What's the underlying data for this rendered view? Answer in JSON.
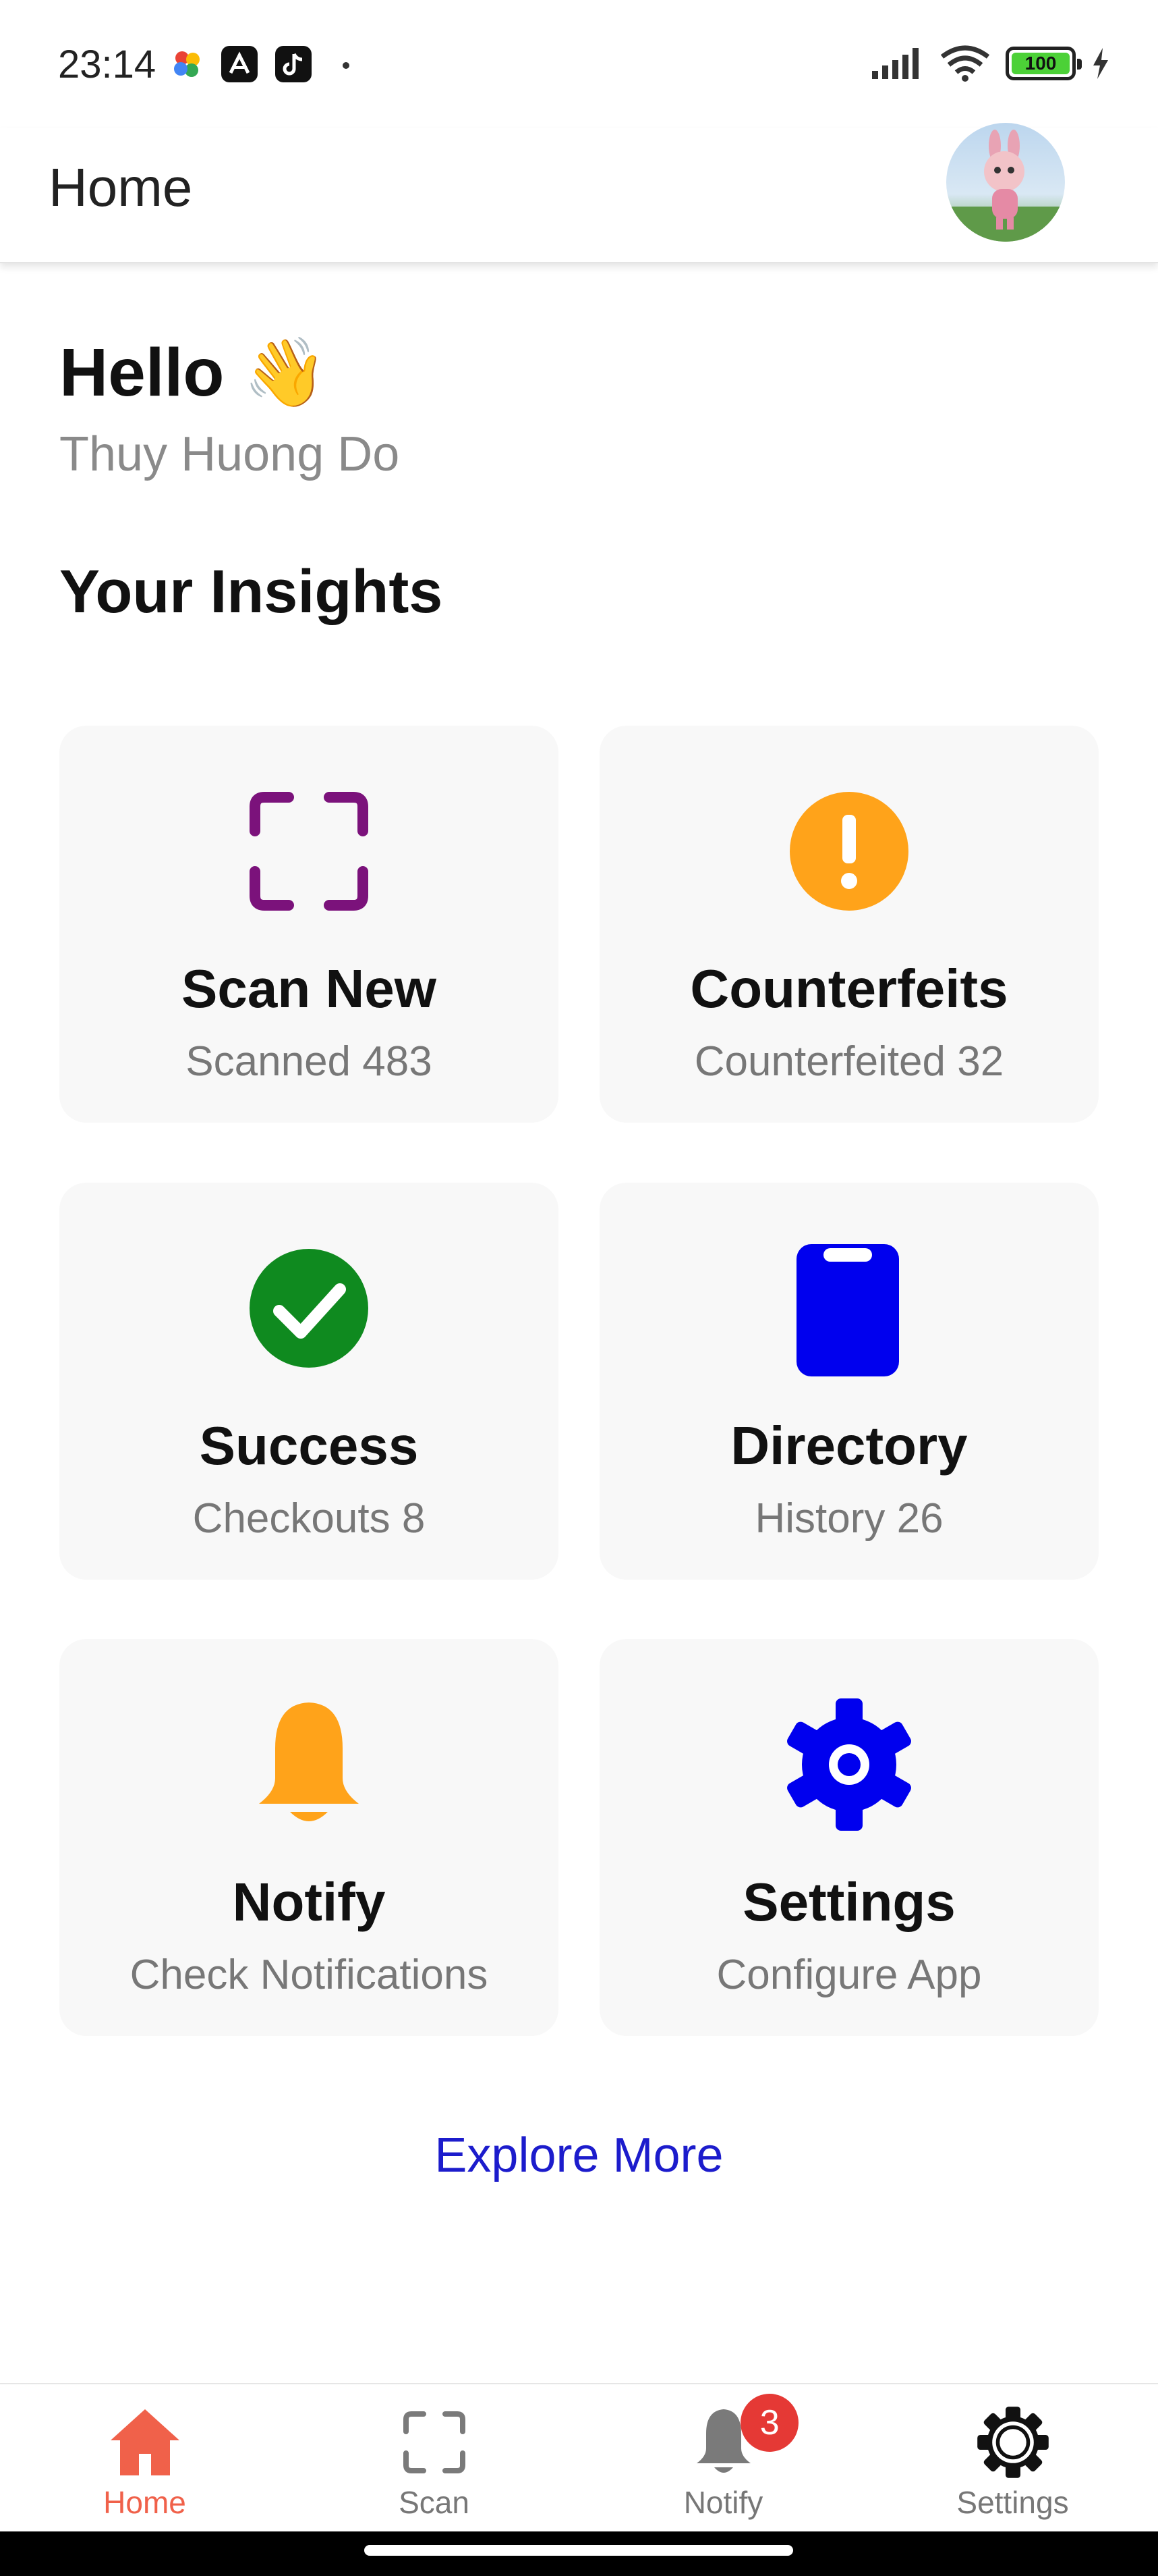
{
  "status_bar": {
    "time": "23:14",
    "battery_level": "100",
    "app_icons": [
      "photos-icon",
      "capcut-icon",
      "tiktok-icon"
    ],
    "indicators": [
      "cellular-signal-icon",
      "wifi-icon",
      "battery-icon",
      "charging-icon"
    ]
  },
  "app_bar": {
    "title": "Home",
    "avatar_icon": "user-avatar"
  },
  "greeting": {
    "hello": "Hello",
    "emoji": "👋",
    "user_name": "Thuy Huong Do"
  },
  "insights": {
    "title": "Your Insights",
    "cards": [
      {
        "title": "Scan New",
        "subtitle": "Scanned 483",
        "icon": "scan-frame-icon",
        "color": "#7b127b"
      },
      {
        "title": "Counterfeits",
        "subtitle": "Counterfeited 32",
        "icon": "warning-icon",
        "color": "#ffa31a"
      },
      {
        "title": "Success",
        "subtitle": "Checkouts 8",
        "icon": "check-circle-icon",
        "color": "#0f8a1f"
      },
      {
        "title": "Directory",
        "subtitle": "History 26",
        "icon": "clipboard-icon",
        "color": "#0000ee"
      },
      {
        "title": "Notify",
        "subtitle": "Check Notifications",
        "icon": "bell-icon",
        "color": "#ffa31a"
      },
      {
        "title": "Settings",
        "subtitle": "Configure App",
        "icon": "gear-icon",
        "color": "#0000ee"
      }
    ]
  },
  "explore_more": "Explore More",
  "bottom_nav": {
    "active_color": "#f0614a",
    "inactive_color": "#7a7a7a",
    "items": [
      {
        "label": "Home",
        "icon": "home-icon",
        "active": true
      },
      {
        "label": "Scan",
        "icon": "scan-icon",
        "active": false
      },
      {
        "label": "Notify",
        "icon": "bell-icon",
        "active": false,
        "badge": "3"
      },
      {
        "label": "Settings",
        "icon": "gear-icon",
        "active": false
      }
    ]
  }
}
